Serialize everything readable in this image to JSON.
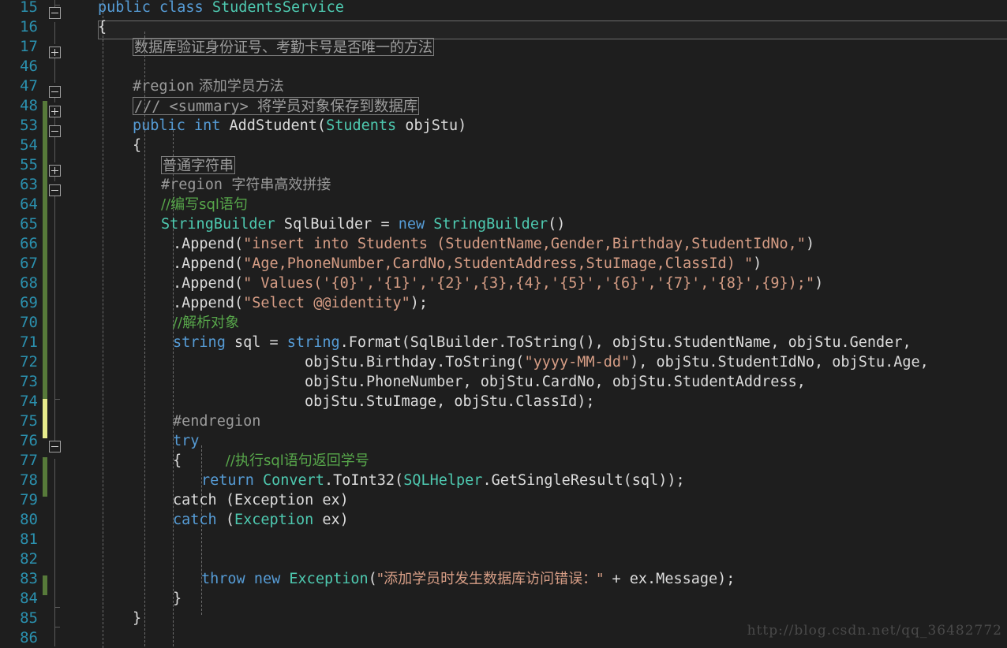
{
  "editor": {
    "theme_background": "#1e1e1e",
    "line_number_color": "#2b91af",
    "language": "csharp",
    "watermark": "http://blog.csdn.net/qq_36482772"
  },
  "colors": {
    "keyword": "#569cd6",
    "type": "#4ec9b0",
    "string": "#d69d85",
    "comment": "#57a64a",
    "directive": "#9b9b9b",
    "plain": "#dcdcdc",
    "change_added": "#577a3a",
    "change_modified": "#e7eb8c"
  },
  "lines": [
    {
      "n": "15",
      "text": "public class StudentsService"
    },
    {
      "n": "16",
      "text": "{"
    },
    {
      "n": "17",
      "text": "数据库验证身份证号、考勤卡号是否唯一的方法"
    },
    {
      "n": "46",
      "text": ""
    },
    {
      "n": "47",
      "text": "#region 添加学员方法"
    },
    {
      "n": "48",
      "text": "/// <summary> 将学员对象保存到数据库"
    },
    {
      "n": "53",
      "text": "public int AddStudent(Students objStu)"
    },
    {
      "n": "54",
      "text": "{"
    },
    {
      "n": "55",
      "text": "普通字符串"
    },
    {
      "n": "63",
      "text": "#region  字符串高效拼接"
    },
    {
      "n": "64",
      "text": "//编写sql语句"
    },
    {
      "n": "65",
      "text": "StringBuilder SqlBuilder = new StringBuilder()"
    },
    {
      "n": "66",
      "text": ".Append(\"insert into Students (StudentName,Gender,Birthday,StudentIdNo,\")"
    },
    {
      "n": "67",
      "text": ".Append(\"Age,PhoneNumber,CardNo,StudentAddress,StuImage,ClassId) \")"
    },
    {
      "n": "68",
      "text": ".Append(\" Values('{0}','{1}','{2}',{3},{4},'{5}','{6}','{7}','{8}',{9});\")"
    },
    {
      "n": "69",
      "text": ".Append(\"Select @@identity\");"
    },
    {
      "n": "70",
      "text": "//解析对象"
    },
    {
      "n": "71",
      "text": "string sql = string.Format(SqlBuilder.ToString(), objStu.StudentName, objStu.Gender,"
    },
    {
      "n": "72",
      "text": "objStu.Birthday.ToString(\"yyyy-MM-dd\"), objStu.StudentIdNo, objStu.Age,"
    },
    {
      "n": "73",
      "text": "objStu.PhoneNumber, objStu.CardNo, objStu.StudentAddress,"
    },
    {
      "n": "74",
      "text": "objStu.StuImage, objStu.ClassId);"
    },
    {
      "n": "75",
      "text": "#endregion"
    },
    {
      "n": "76",
      "text": "try"
    },
    {
      "n": "77",
      "text": "{     //执行sql语句返回学号"
    },
    {
      "n": "78",
      "text": "return Convert.ToInt32(SQLHelper.GetSingleResult(sql));"
    },
    {
      "n": "79",
      "text": "}"
    },
    {
      "n": "80",
      "text": "catch (Exception ex)"
    },
    {
      "n": "81",
      "text": "{"
    },
    {
      "n": "82",
      "text": ""
    },
    {
      "n": "83",
      "text": "throw new Exception(\"添加学员时发生数据库访问错误：\" + ex.Message);"
    },
    {
      "n": "84",
      "text": "}"
    },
    {
      "n": "85",
      "text": "}"
    },
    {
      "n": "86",
      "text": ""
    }
  ],
  "collapsed_regions": [
    {
      "line": "17",
      "label": "数据库验证身份证号、考勤卡号是否唯一的方法"
    },
    {
      "line": "48",
      "label": "/// <summary> 将学员对象保存到数据库"
    },
    {
      "line": "55",
      "label": "普通字符串"
    }
  ],
  "fold_markers": [
    {
      "line": "15",
      "state": "expanded"
    },
    {
      "line": "17",
      "state": "collapsed"
    },
    {
      "line": "47",
      "state": "expanded"
    },
    {
      "line": "48",
      "state": "collapsed"
    },
    {
      "line": "53",
      "state": "expanded"
    },
    {
      "line": "55",
      "state": "collapsed"
    },
    {
      "line": "63",
      "state": "expanded"
    },
    {
      "line": "76",
      "state": "expanded"
    }
  ],
  "tokens": {
    "l15": {
      "a": "public",
      "b": "class",
      "c": "StudentsService"
    },
    "l47": {
      "a": "#region",
      "b": " 添加学员方法"
    },
    "l53": {
      "a": "public",
      "b": "int",
      "c": "AddStudent",
      "d": "Students",
      "e": "objStu"
    },
    "l63": {
      "a": "#region",
      "b": "  字符串高效拼接"
    },
    "l64": {
      "a": "//编写sql语句"
    },
    "l65": {
      "a": "StringBuilder",
      "b": " SqlBuilder = ",
      "c": "new",
      "d": "StringBuilder",
      "e": "()"
    },
    "l66": {
      "a": ".Append(",
      "b": "\"insert into Students (StudentName,Gender,Birthday,StudentIdNo,\"",
      "c": ")"
    },
    "l67": {
      "a": ".Append(",
      "b": "\"Age,PhoneNumber,CardNo,StudentAddress,StuImage,ClassId) \"",
      "c": ")"
    },
    "l68": {
      "a": ".Append(",
      "b": "\" Values('{0}','{1}','{2}',{3},{4},'{5}','{6}','{7}','{8}',{9});\"",
      "c": ")"
    },
    "l69": {
      "a": ".Append(",
      "b": "\"Select @@identity\"",
      "c": ");"
    },
    "l70": {
      "a": "//解析对象"
    },
    "l71": {
      "a": "string",
      "b": " sql = ",
      "c": "string",
      "d": ".Format(SqlBuilder.ToString(), objStu.StudentName, objStu.Gender,"
    },
    "l72": {
      "a": "objStu.Birthday.ToString(",
      "b": "\"yyyy-MM-dd\"",
      "c": "), objStu.StudentIdNo, objStu.Age,"
    },
    "l73": {
      "a": "objStu.PhoneNumber, objStu.CardNo, objStu.StudentAddress,"
    },
    "l74": {
      "a": "objStu.StuImage, objStu.ClassId);"
    },
    "l75": {
      "a": "#endregion"
    },
    "l76": {
      "a": "try"
    },
    "l77": {
      "a": "{",
      "b": "     ",
      "c": "//执行sql语句返回学号"
    },
    "l78": {
      "a": "return",
      "b": "Convert",
      "c": ".ToInt32(",
      "d": "SQLHelper",
      "e": ".GetSingleResult(sql));"
    },
    "l80": {
      "a": "catch",
      "b": " (",
      "c": "Exception",
      "d": " ex)"
    },
    "l83": {
      "a": "throw",
      "b": "new",
      "c": "Exception",
      "d": "(",
      "e": "\"添加学员时发生数据库访问错误：\"",
      "f": " + ex.Message);"
    }
  }
}
